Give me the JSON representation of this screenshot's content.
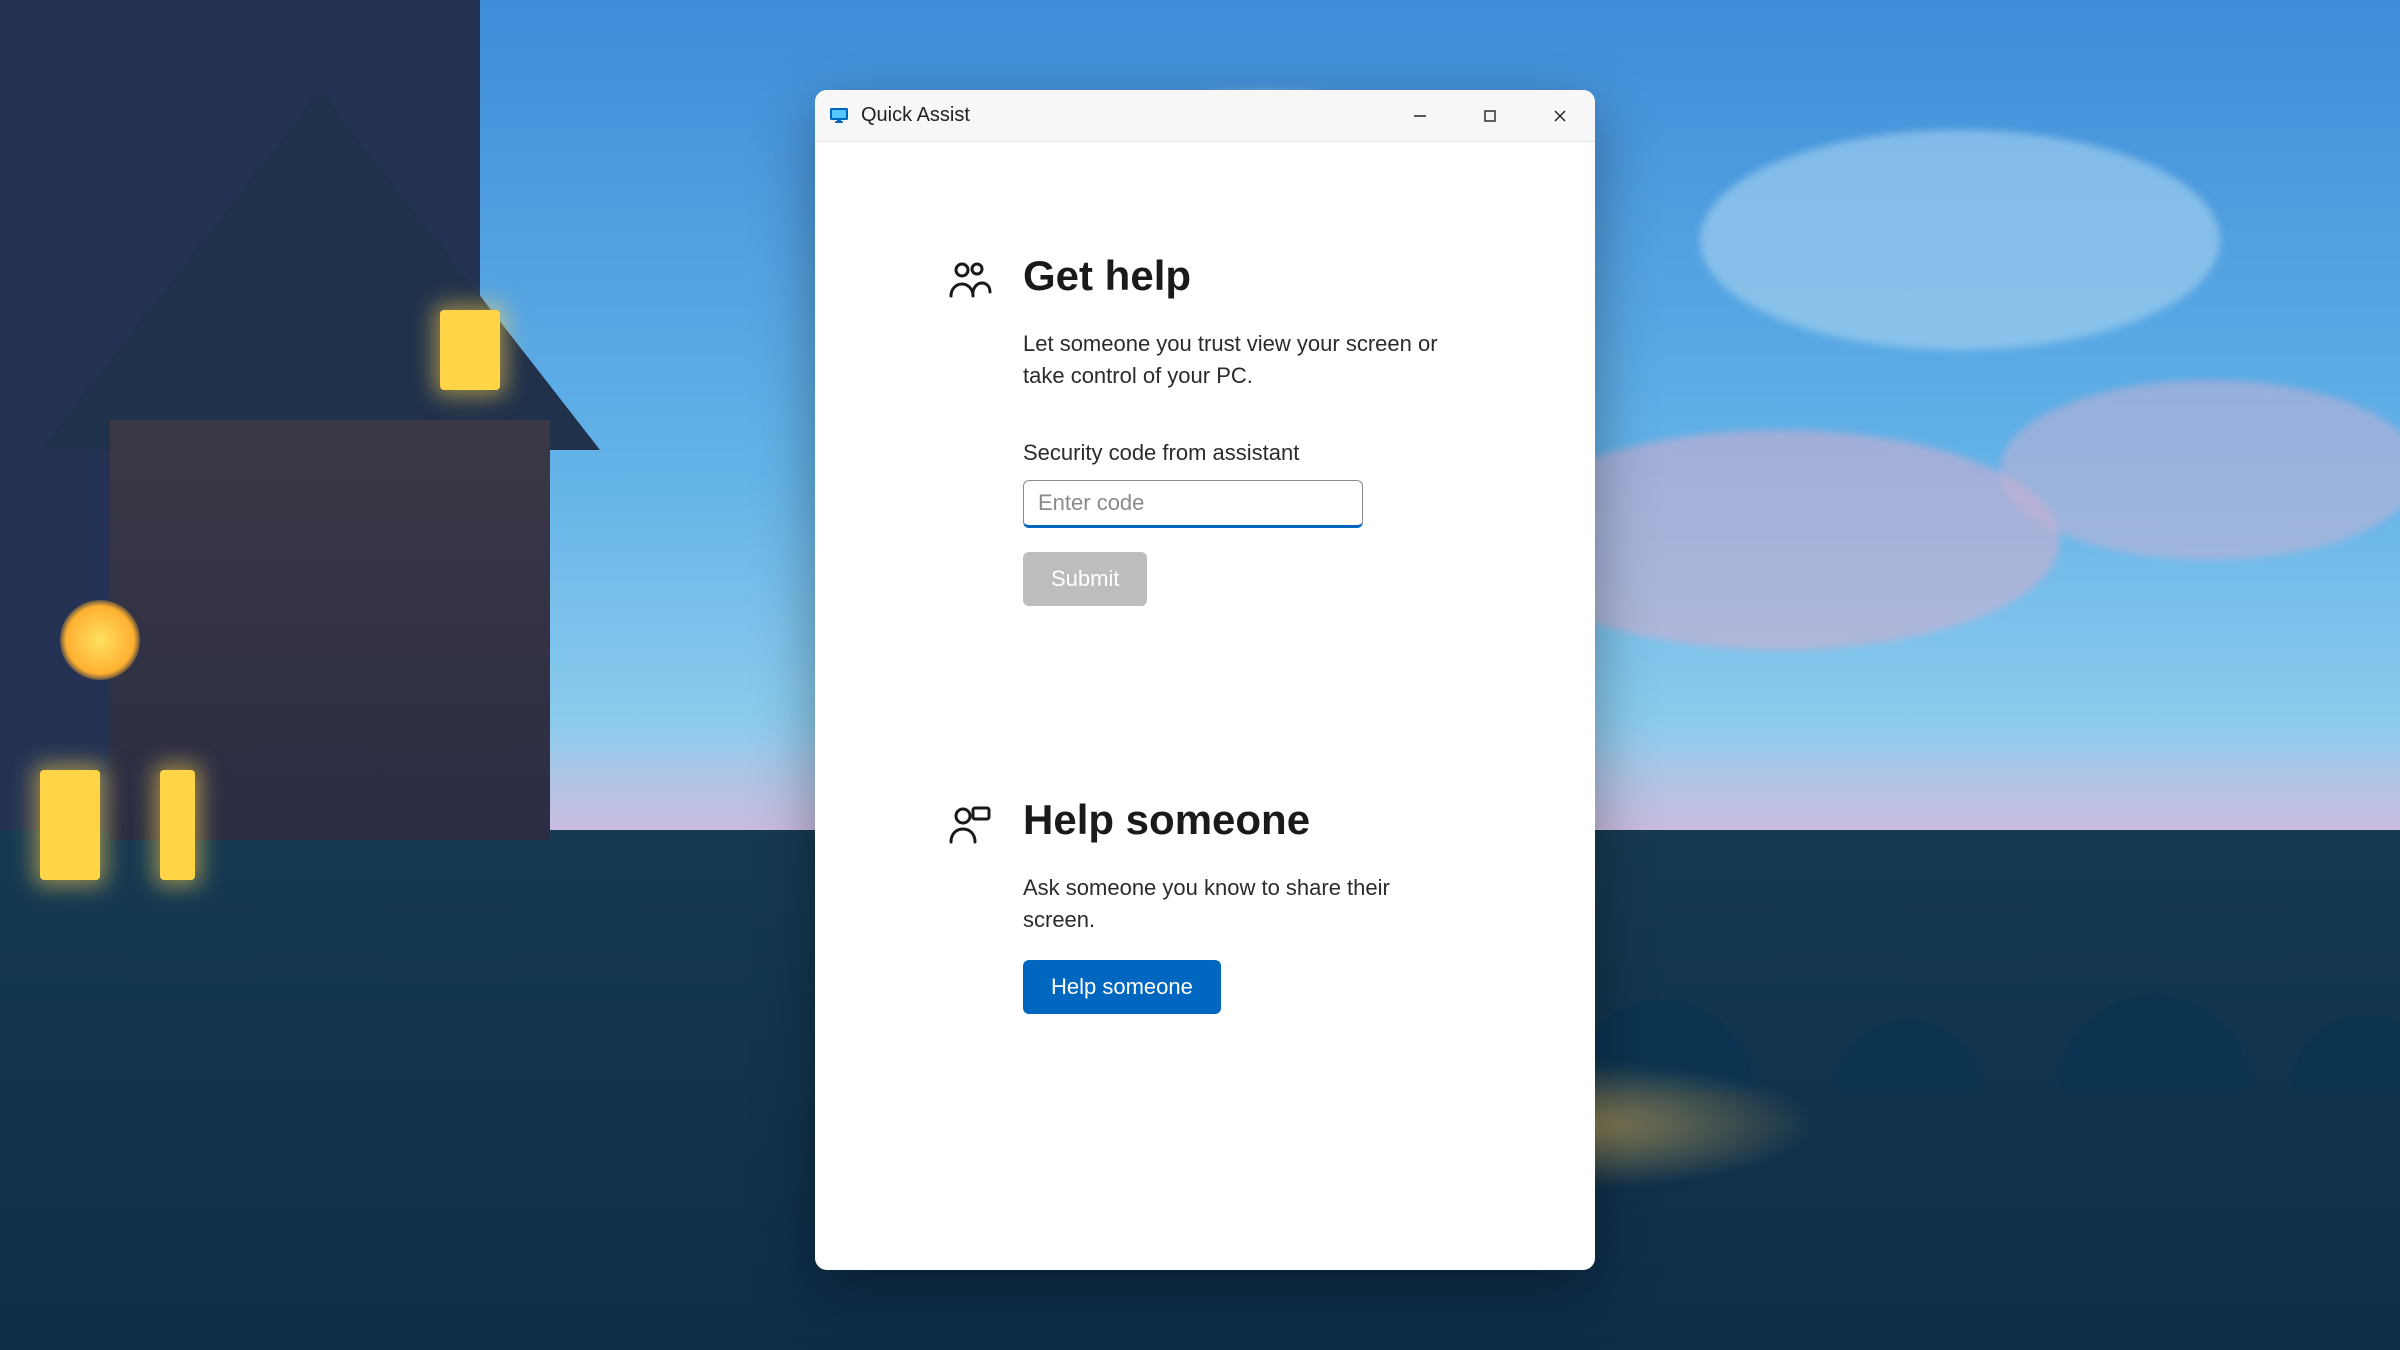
{
  "window": {
    "title": "Quick Assist"
  },
  "get_help": {
    "heading": "Get help",
    "description": "Let someone you trust view your screen or take control of your PC.",
    "code_label": "Security code from assistant",
    "code_placeholder": "Enter code",
    "code_value": "",
    "submit_label": "Submit"
  },
  "help_someone": {
    "heading": "Help someone",
    "description": "Ask someone you know to share their screen.",
    "button_label": "Help someone"
  },
  "colors": {
    "accent": "#0067c0",
    "disabled": "#bdbdbd"
  }
}
